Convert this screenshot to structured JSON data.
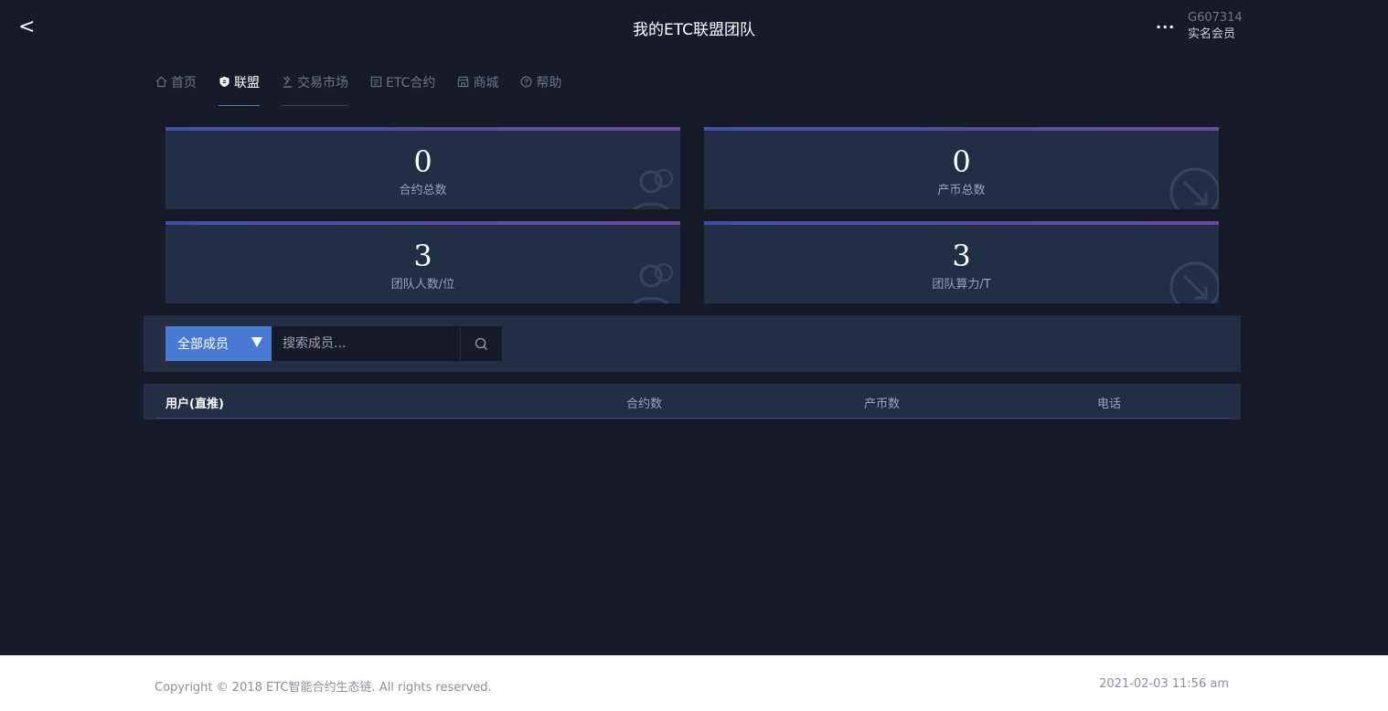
{
  "header": {
    "back_symbol": "<",
    "title": "我的ETC联盟团队",
    "more_symbol": "···",
    "user_id": "G607314",
    "user_role": "实名会员"
  },
  "nav": {
    "items": [
      {
        "label": "首页",
        "icon": "home-icon"
      },
      {
        "label": "联盟",
        "icon": "shield-icon"
      },
      {
        "label": "交易市场",
        "icon": "gavel-icon"
      },
      {
        "label": "ETC合约",
        "icon": "contract-icon"
      },
      {
        "label": "商城",
        "icon": "shop-icon"
      },
      {
        "label": "帮助",
        "icon": "help-icon"
      }
    ],
    "active": "联盟"
  },
  "stats": [
    {
      "value": "0",
      "label": "合约总数"
    },
    {
      "value": "0",
      "label": "产币总数"
    },
    {
      "value": "3",
      "label": "团队人数/位"
    },
    {
      "value": "3",
      "label": "团队算力/T"
    }
  ],
  "filter": {
    "select_label": "全部成员",
    "search_placeholder": "搜索成员..."
  },
  "table": {
    "headers": [
      "用户(直推)",
      "合约数",
      "产币数",
      "电话"
    ]
  },
  "footer": {
    "copyright": "Copyright © 2018 ETC智能合约生态链. All rights reserved.",
    "timestamp": "2021-02-03 11:56 am"
  },
  "colors": {
    "background": "#161b27",
    "card": "#232d45",
    "accent": "#4a7bd4"
  }
}
